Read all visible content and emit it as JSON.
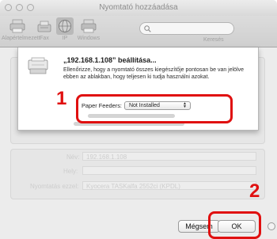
{
  "window": {
    "title": "Nyomtató hozzáadása"
  },
  "toolbar": {
    "items": [
      {
        "label": "Alapértelmezett",
        "icon": "default-printer-icon"
      },
      {
        "label": "Fax",
        "icon": "fax-icon"
      },
      {
        "label": "IP",
        "icon": "ip-globe-icon"
      },
      {
        "label": "Windows",
        "icon": "windows-printer-icon"
      }
    ],
    "search_label": "Keresés",
    "search_value": ""
  },
  "sheet": {
    "title": "„192.168.1.108” beállítása...",
    "message": "Ellenőrizze, hogy a nyomtató összes kiegészítője pontosan be van jelölve ebben az ablakban, hogy teljesen ki tudja használni azokat.",
    "feeder_label": "Paper Feeders:",
    "feeder_value": "Not Installed"
  },
  "background_form": {
    "name_label": "Név:",
    "name_value": "192.168.1.108",
    "location_label": "Hely:",
    "driver_label": "Nyomtatás ezzel:",
    "driver_value": "Kyocera TASKalfa 2552ci (KPDL)"
  },
  "buttons": {
    "cancel": "Mégsem",
    "ok": "OK"
  },
  "annotations": {
    "step1": "1",
    "step2": "2",
    "color": "#e01010"
  }
}
